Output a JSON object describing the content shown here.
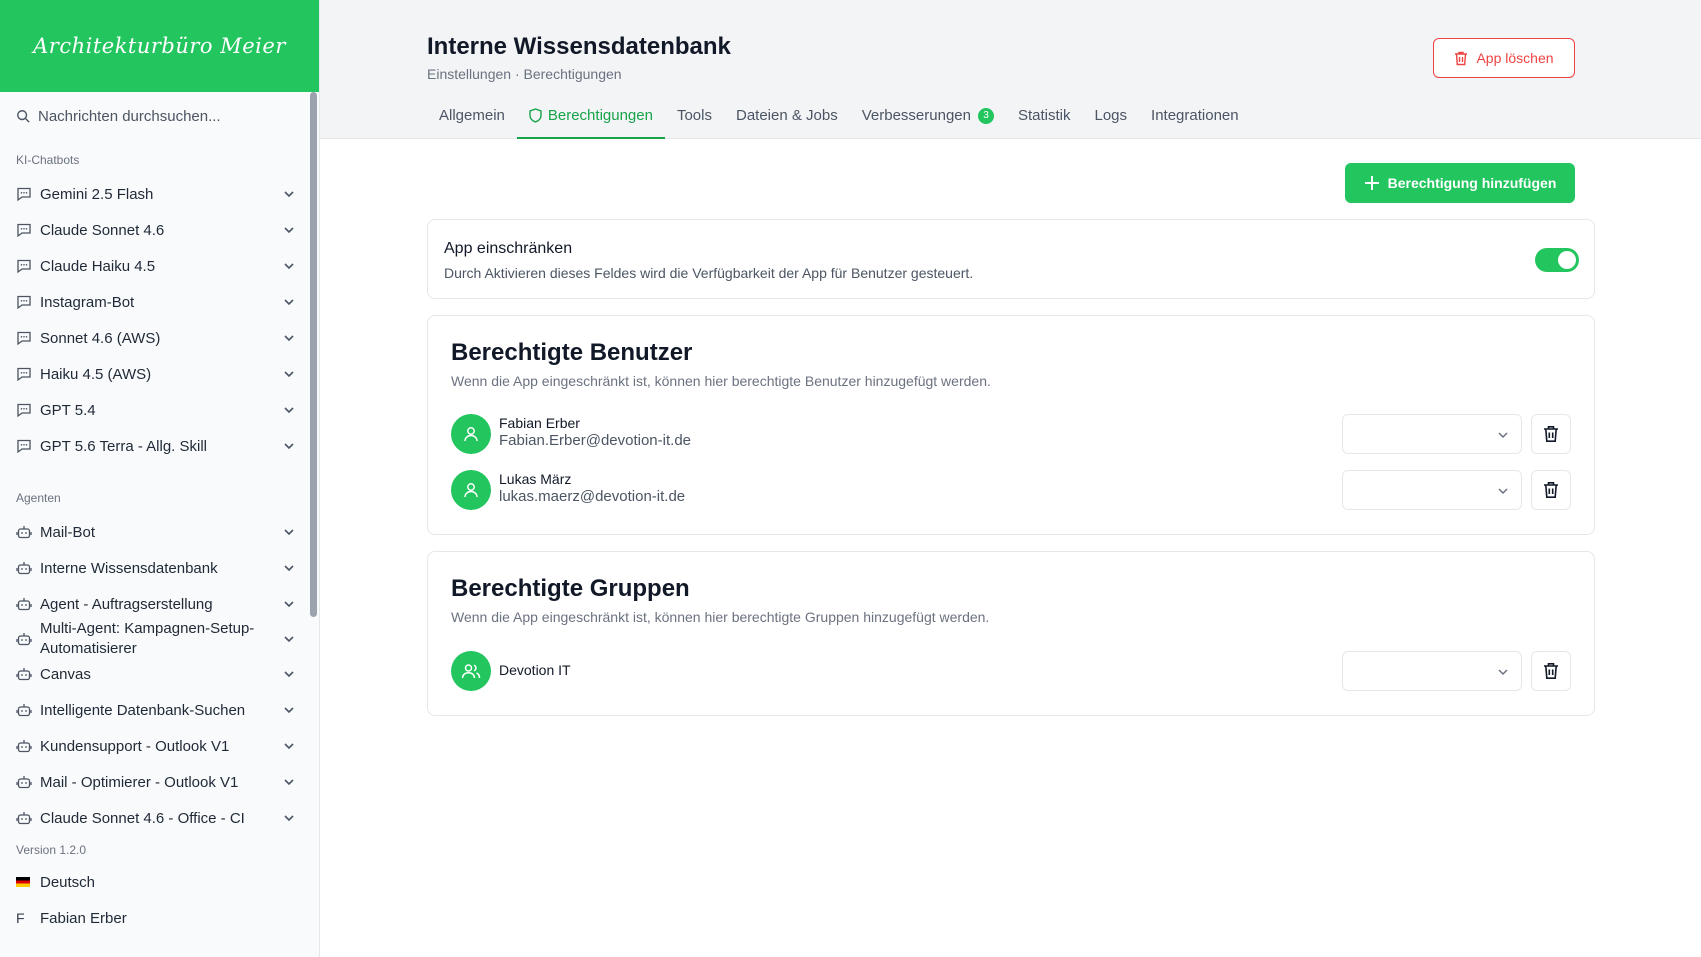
{
  "brand": {
    "logo_text": "Architekturbüro Meier",
    "accent": "#22c55e"
  },
  "sidebar": {
    "search_placeholder": "Nachrichten durchsuchen...",
    "chatbots_label": "KI-Chatbots",
    "chatbots": [
      {
        "label": "Gemini 2.5 Flash"
      },
      {
        "label": "Claude Sonnet 4.6"
      },
      {
        "label": "Claude Haiku 4.5"
      },
      {
        "label": "Instagram-Bot"
      },
      {
        "label": "Sonnet 4.6 (AWS)"
      },
      {
        "label": "Haiku 4.5 (AWS)"
      },
      {
        "label": "GPT 5.4"
      },
      {
        "label": "GPT 5.6 Terra - Allg. Skill"
      }
    ],
    "agents_label": "Agenten",
    "agents": [
      {
        "label": "Mail-Bot"
      },
      {
        "label": "Interne Wissensdatenbank"
      },
      {
        "label": "Agent - Auftragserstellung"
      },
      {
        "label": "Multi-Agent: Kampagnen-Setup-Automatisierer"
      },
      {
        "label": "Canvas"
      },
      {
        "label": "Intelligente Datenbank-Suchen"
      },
      {
        "label": "Kundensupport - Outlook V1"
      },
      {
        "label": "Mail - Optimierer - Outlook V1"
      },
      {
        "label": "Claude Sonnet 4.6 - Office - CI"
      }
    ],
    "version": "Version 1.2.0",
    "language": "Deutsch",
    "user_initial": "F",
    "user_name": "Fabian Erber"
  },
  "header": {
    "title": "Interne Wissensdatenbank",
    "breadcrumb": "Einstellungen · Berechtigungen",
    "delete_label": "App löschen",
    "tabs": [
      {
        "label": "Allgemein"
      },
      {
        "label": "Berechtigungen",
        "active": true
      },
      {
        "label": "Tools"
      },
      {
        "label": "Dateien & Jobs"
      },
      {
        "label": "Verbesserungen",
        "badge": "3"
      },
      {
        "label": "Statistik"
      },
      {
        "label": "Logs"
      },
      {
        "label": "Integrationen"
      }
    ]
  },
  "content": {
    "add_label": "Berechtigung hinzufügen",
    "restrict": {
      "title": "App einschränken",
      "description": "Durch Aktivieren dieses Feldes wird die Verfügbarkeit der App für Benutzer gesteuert.",
      "enabled": true
    },
    "users": {
      "title": "Berechtigte Benutzer",
      "description": "Wenn die App eingeschränkt ist, können hier berechtigte Benutzer hinzugefügt werden.",
      "items": [
        {
          "name": "Fabian Erber",
          "email": "Fabian.Erber@devotion-it.de",
          "role": ""
        },
        {
          "name": "Lukas März",
          "email": "lukas.maerz@devotion-it.de",
          "role": ""
        }
      ]
    },
    "groups": {
      "title": "Berechtigte Gruppen",
      "description": "Wenn die App eingeschränkt ist, können hier berechtigte Gruppen hinzugefügt werden.",
      "items": [
        {
          "name": "Devotion IT",
          "role": ""
        }
      ]
    }
  }
}
